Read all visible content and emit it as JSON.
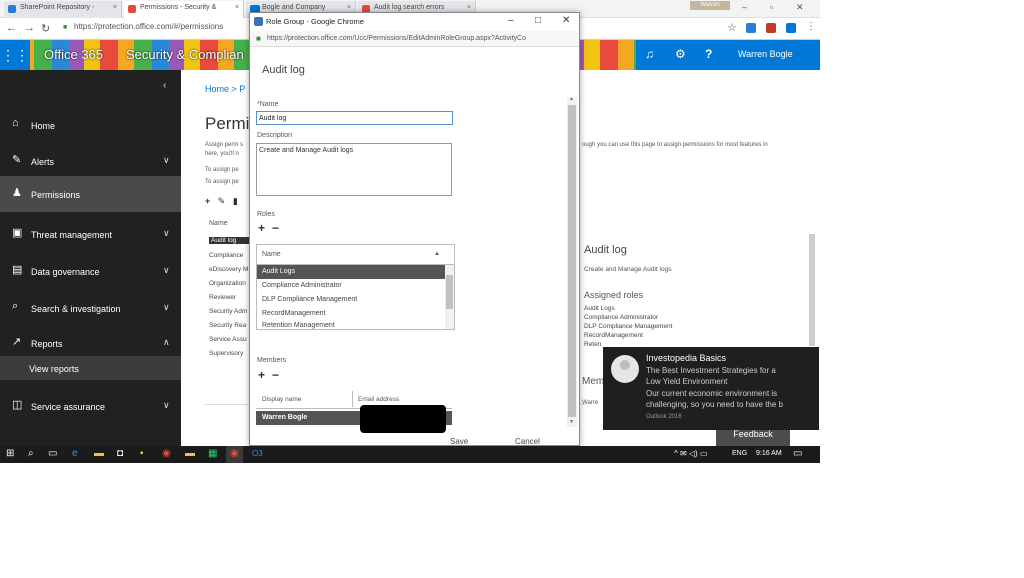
{
  "browser": {
    "tabs": [
      {
        "label": "SharePoint Repository -",
        "favicon_color": "#2b7cd3"
      },
      {
        "label": "Permissions - Security &",
        "favicon_color": "#e84b3c"
      },
      {
        "label": "Bogle and Company",
        "favicon_color": "#0078d7"
      },
      {
        "label": "Audit log search errors",
        "favicon_color": "#e84b3c"
      }
    ],
    "tab_badge": "24",
    "profile_badge": "Warren",
    "url": "https://protection.office.com/#/permissions"
  },
  "header": {
    "brand_office": "Office 365",
    "brand_app": "Security & Complian",
    "user_name": "Warren Bogle",
    "accent_color": "#0078d7"
  },
  "nav": {
    "items": [
      {
        "label": "Home",
        "icon": "home-icon"
      },
      {
        "label": "Alerts",
        "icon": "wrench-icon"
      },
      {
        "label": "Permissions",
        "icon": "people-icon"
      },
      {
        "label": "Threat management",
        "icon": "lock-icon"
      },
      {
        "label": "Data governance",
        "icon": "document-icon"
      },
      {
        "label": "Search & investigation",
        "icon": "search-icon"
      },
      {
        "label": "Reports",
        "icon": "chart-icon"
      },
      {
        "label": "Service assurance",
        "icon": "shield-icon"
      }
    ],
    "subitem": "View reports"
  },
  "main": {
    "breadcrumb": "Home  >  P",
    "title": "Permis",
    "desc_line1": "Assign perm s",
    "desc_line2": "here, you'll n",
    "desc_line3": "To assign pe",
    "desc_line4": "To assign pe",
    "desc_right1": "ough you can use this page to assign permissions for most features in",
    "list_header": "Name",
    "list": [
      "Audit log",
      "Compliance",
      "eDiscovery M",
      "Organization",
      "Reviewer",
      "Security Adm",
      "Security Rea",
      "Service Assu",
      "Supervisory"
    ],
    "detail": {
      "title": "Audit log",
      "desc": "Create and Manage Audit logs",
      "roles_label": "Assigned roles",
      "roles": [
        "Audit Logs",
        "Compliance Administrator",
        "DLP Compliance Management",
        "RecordManagement",
        "Reten"
      ]
    },
    "members_label": "Mem",
    "members_sub": "Warre",
    "feedback": "Feedback"
  },
  "dialog": {
    "window_title": "Role Group - Google Chrome",
    "url": "https://protection.office.com/Ucc/Permissions/EditAdminRoleGroup.aspx?ActivityCo",
    "heading": "Audit log",
    "name_label": "*Name",
    "name_value": "Audit log",
    "description_label": "Description",
    "description_value": "Create and Manage Audit logs",
    "roles_label": "Roles",
    "roles_column": "Name",
    "roles": [
      "Audit Logs",
      "Compliance Administrator",
      "DLP Compliance Management",
      "RecordManagement",
      "Retention Management"
    ],
    "members_label": "Members",
    "members_col_display": "Display name",
    "members_col_email": "Email address",
    "member_name": "Warren Bogle",
    "save_label": "Save",
    "cancel_label": "Cancel"
  },
  "toast": {
    "title": "Investopedia Basics",
    "line1": "The Best Investment Strategies for a",
    "line2": "Low Yield Environment",
    "line3": "Our current economic environment is",
    "line4": "challenging, so you need to have the b",
    "source": "Outlook 2016"
  },
  "taskbar": {
    "language": "ENG",
    "time": "9:16 AM"
  }
}
